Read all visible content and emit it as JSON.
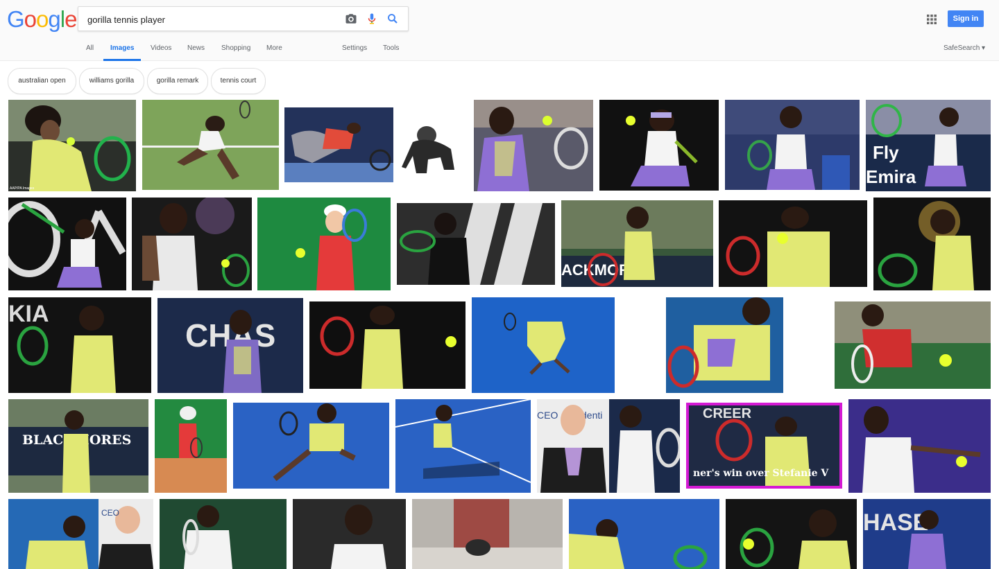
{
  "header": {
    "logo_letters": [
      "G",
      "o",
      "o",
      "g",
      "l",
      "e"
    ],
    "search_query": "gorilla tennis player",
    "sign_in_label": "Sign in"
  },
  "tabs": {
    "items": [
      "All",
      "Images",
      "Videos",
      "News",
      "Shopping",
      "More"
    ],
    "active": "Images",
    "settings_label": "Settings",
    "tools_label": "Tools",
    "safesearch_label": "SafeSearch ▾"
  },
  "chips": [
    "australian open",
    "williams gorilla",
    "gorilla remark",
    "tennis court"
  ],
  "thumbnails": {
    "overlay_text": "ner's win over Stefanie V",
    "watermark_text": "AAP/PA Images"
  },
  "colors": {
    "accent_blue": "#4285f4",
    "tab_active": "#1a73e8",
    "header_bg": "#fafafa"
  }
}
